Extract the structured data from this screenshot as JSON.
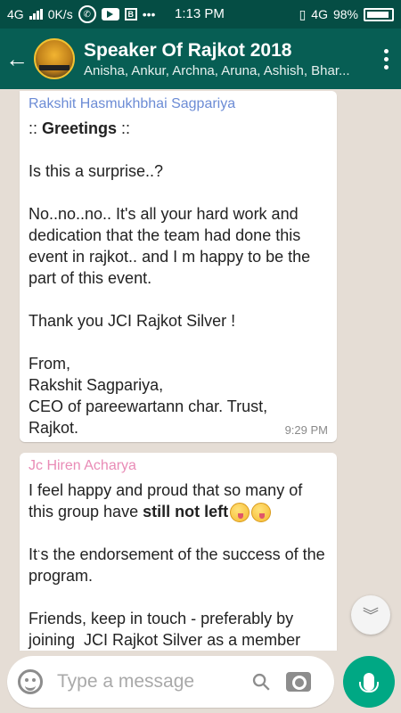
{
  "status_bar": {
    "network": "4G",
    "speed": "0K/s",
    "dots": "•••",
    "time": "1:13 PM",
    "network_right": "4G",
    "battery": "98%"
  },
  "header": {
    "title": "Speaker Of Rajkot 2018",
    "subtitle": "Anisha, Ankur, Archna, Aruna, Ashish, Bhar..."
  },
  "messages": [
    {
      "sender": "Rakshit Hasmukhbhai Sagpariya",
      "greeting": "Greetings",
      "text": "Is this a surprise..?\n\nNo..no..no.. It's all your hard work and dedication that the team had done this event in rajkot.. and I m happy to be the part of this event.\n\nThank you JCI Rajkot Silver !\n\nFrom,\nRakshit Sagpariya,\nCEO of pareewartann char. Trust,\nRajkot.",
      "time": "9:29 PM"
    },
    {
      "sender": "Jc Hiren Acharya",
      "text_before": "I feel happy and proud that so many of this group have ",
      "bold": "still not left",
      "text_after": "\n\nIt's the endorsement of the success of the program.\n\nFriends, keep in touch - preferably by joining  JCI Rajkot Silver as a member"
    }
  ],
  "composer": {
    "placeholder": "Type a message"
  },
  "colors": {
    "status_bar": "#054d44",
    "app_bar": "#075e54",
    "chat_bg": "#e5ddd5",
    "mic_button": "#00a884",
    "sender1": "#6c8cd5",
    "sender2": "#e98bb6"
  },
  "icons": [
    "back-arrow-icon",
    "more-vert-icon",
    "emoji-icon",
    "attach-icon",
    "camera-icon",
    "mic-icon",
    "scroll-down-icon"
  ]
}
